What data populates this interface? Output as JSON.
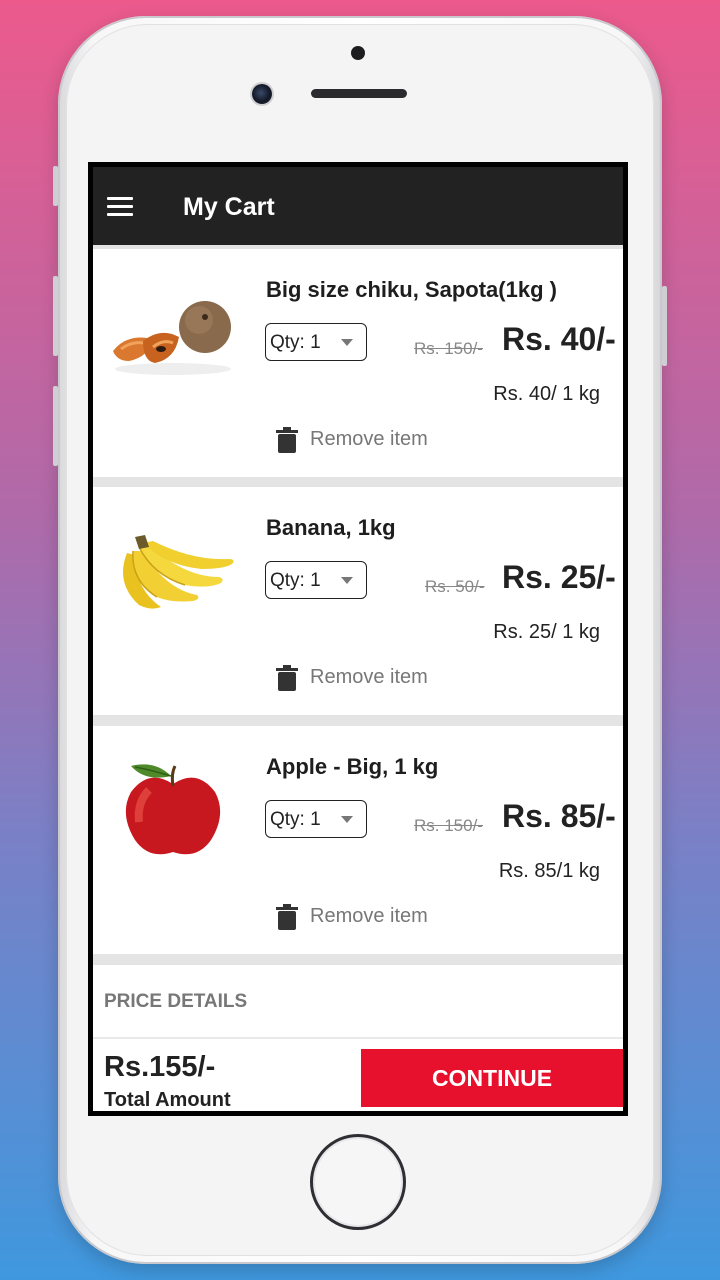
{
  "app": {
    "title": "My Cart"
  },
  "cart": {
    "items": [
      {
        "name": "Big size chiku, Sapota(1kg )",
        "qty_label": "Qty: 1",
        "old_price": "Rs. 150/-",
        "price": "Rs. 40/-",
        "unit_price": "Rs. 40/ 1 kg",
        "remove_label": "Remove item"
      },
      {
        "name": "Banana, 1kg",
        "qty_label": "Qty: 1",
        "old_price": "Rs. 50/-",
        "price": "Rs. 25/-",
        "unit_price": "Rs. 25/ 1 kg",
        "remove_label": "Remove item"
      },
      {
        "name": "Apple - Big, 1 kg",
        "qty_label": "Qty: 1",
        "old_price": "Rs. 150/-",
        "price": "Rs. 85/-",
        "unit_price": "Rs. 85/1 kg",
        "remove_label": "Remove item"
      }
    ]
  },
  "price_details": {
    "label": "PRICE DETAILS"
  },
  "footer": {
    "total_value": "Rs.155/-",
    "total_label": "Total Amount",
    "continue_label": "CONTINUE"
  },
  "colors": {
    "appbar": "#222222",
    "accent": "#e8112d"
  },
  "icons": {
    "menu": "menu-icon",
    "trash": "trash-icon"
  }
}
